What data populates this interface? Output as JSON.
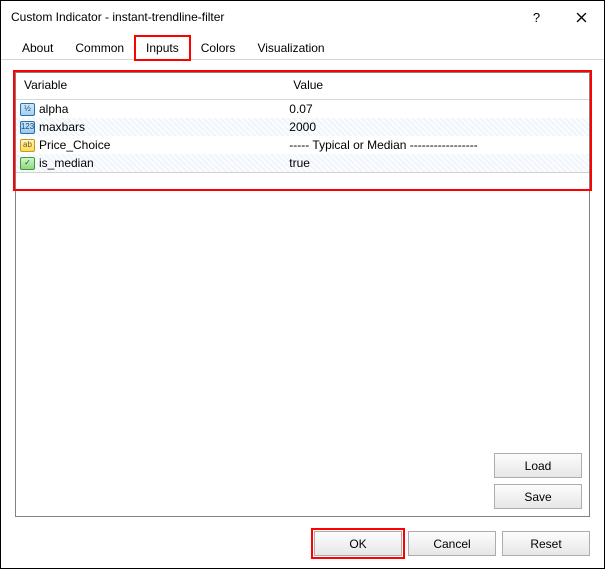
{
  "window": {
    "title": "Custom Indicator - instant-trendline-filter"
  },
  "tabs": [
    "About",
    "Common",
    "Inputs",
    "Colors",
    "Visualization"
  ],
  "active_tab_index": 2,
  "grid": {
    "headers": {
      "variable": "Variable",
      "value": "Value"
    },
    "rows": [
      {
        "icon": "double",
        "icon_text": "½",
        "name": "alpha",
        "value": "0.07"
      },
      {
        "icon": "int",
        "icon_text": "123",
        "name": "maxbars",
        "value": "2000"
      },
      {
        "icon": "str",
        "icon_text": "ab",
        "name": "Price_Choice",
        "value": "-----  Typical or Median  -----------------"
      },
      {
        "icon": "bool",
        "icon_text": "✓",
        "name": "is_median",
        "value": "true"
      }
    ]
  },
  "buttons": {
    "load": "Load",
    "save": "Save",
    "ok": "OK",
    "cancel": "Cancel",
    "reset": "Reset"
  }
}
